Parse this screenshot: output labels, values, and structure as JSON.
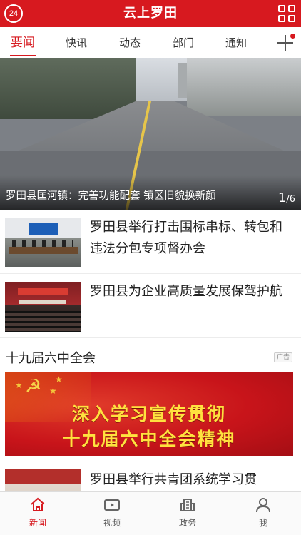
{
  "header": {
    "logo_text": "24",
    "title": "云上罗田"
  },
  "tabs": [
    {
      "label": "要闻",
      "active": true
    },
    {
      "label": "快讯"
    },
    {
      "label": "动态"
    },
    {
      "label": "部门"
    },
    {
      "label": "通知"
    }
  ],
  "hero": {
    "caption": "罗田县匡河镇：完善功能配套 镇区旧貌换新颜",
    "current": "1",
    "total": "6"
  },
  "news": [
    {
      "title": "罗田县举行打击围标串标、转包和违法分包专项督办会"
    },
    {
      "title": "罗田县为企业高质量发展保驾护航"
    }
  ],
  "section": {
    "title": "十九届六中全会",
    "ad_tag": "广告",
    "banner_line1": "深入学习宣传贯彻",
    "banner_line2": "十九届六中全会精神"
  },
  "partial_news": {
    "title": "罗田县举行共青团系统学习贯"
  },
  "bottom_nav": [
    {
      "label": "新闻",
      "icon": "home-icon",
      "active": true
    },
    {
      "label": "视频",
      "icon": "video-icon"
    },
    {
      "label": "政务",
      "icon": "building-icon"
    },
    {
      "label": "我",
      "icon": "user-icon"
    }
  ],
  "colors": {
    "brand_red": "#d7191f",
    "banner_text": "#ffe23f"
  }
}
